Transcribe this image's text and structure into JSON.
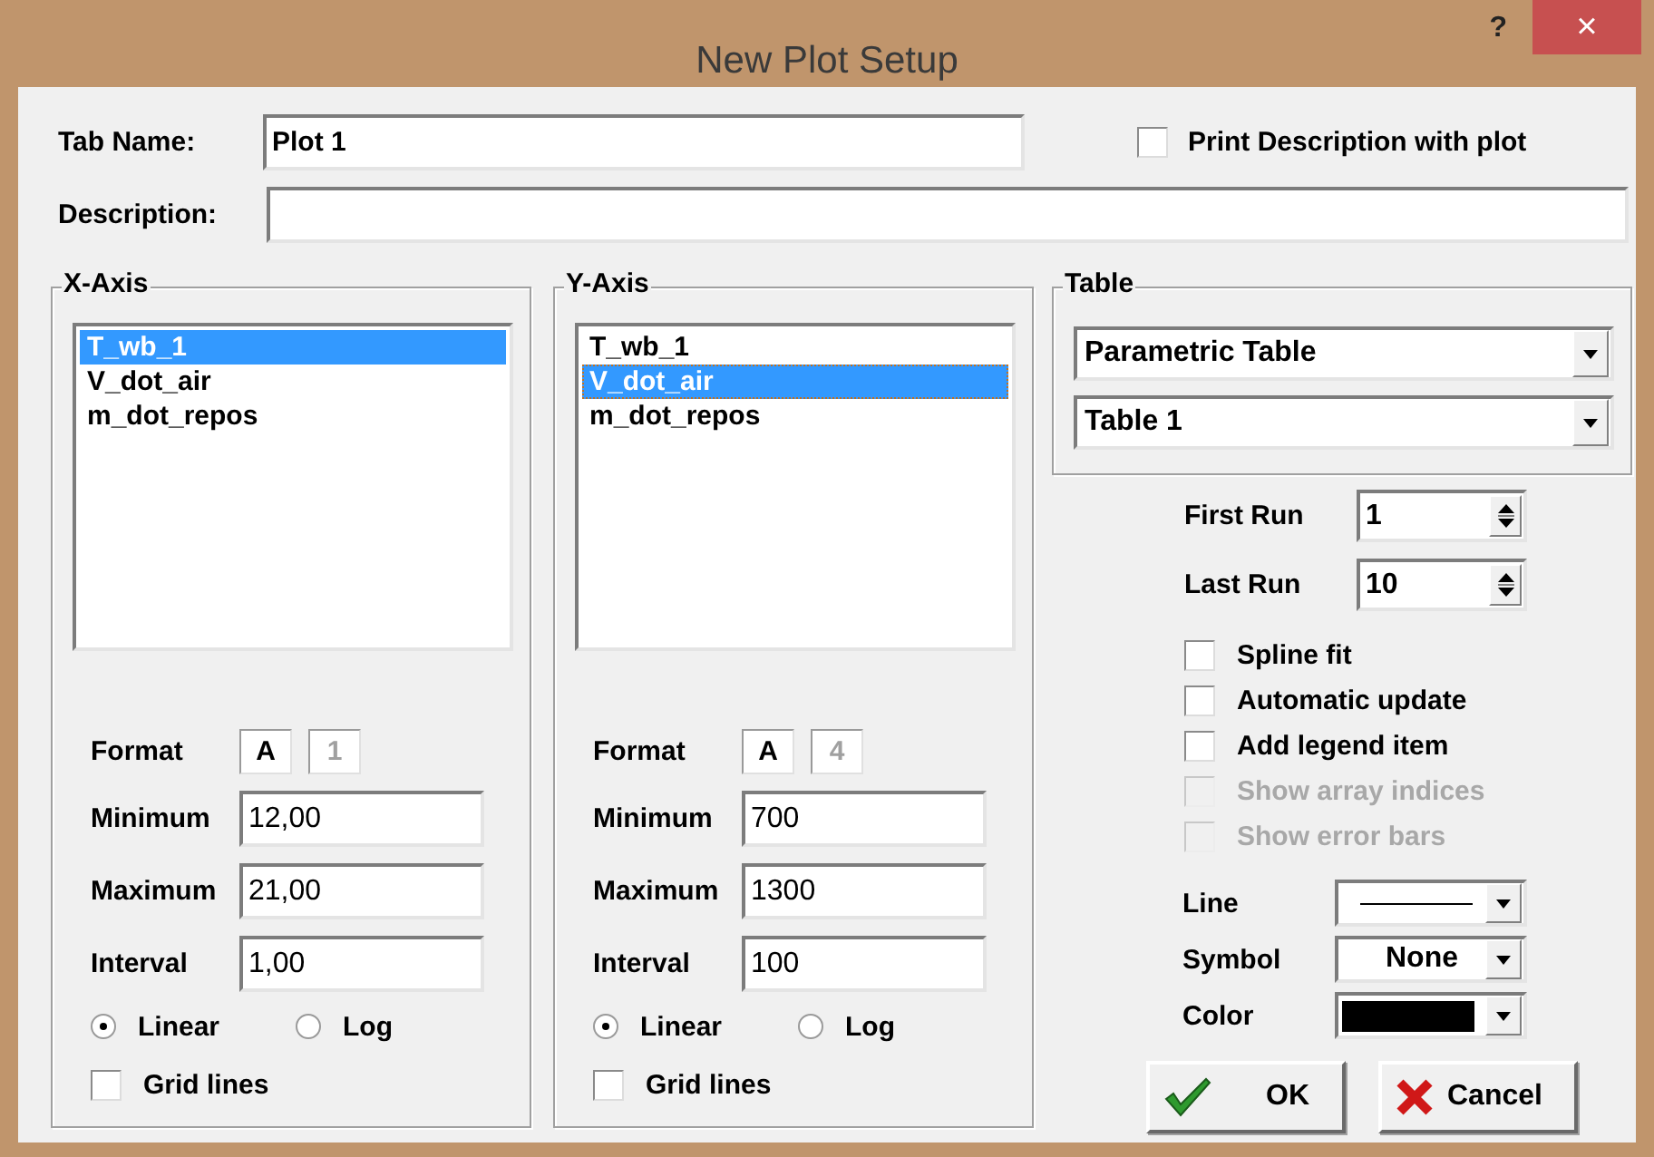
{
  "window": {
    "title": "New Plot Setup",
    "help": "?",
    "close": "×"
  },
  "tab_name": {
    "label": "Tab Name:",
    "value": "Plot 1"
  },
  "print_description": {
    "label": "Print Description with plot",
    "checked": false
  },
  "description": {
    "label": "Description:"
  },
  "axes": [
    {
      "title": "X-Axis",
      "variables": [
        {
          "name": "T_wb_1",
          "selected": true,
          "focused": false
        },
        {
          "name": "V_dot_air",
          "selected": false,
          "focused": false
        },
        {
          "name": "m_dot_repos",
          "selected": false,
          "focused": false
        }
      ],
      "format": {
        "label": "Format",
        "buttons": [
          {
            "text": "A",
            "disabled": false
          },
          {
            "text": "1",
            "disabled": true
          }
        ]
      },
      "fields": [
        {
          "label": "Minimum",
          "value": "12,00"
        },
        {
          "label": "Maximum",
          "value": "21,00"
        },
        {
          "label": "Interval",
          "value": "1,00"
        }
      ],
      "scale": [
        {
          "label": "Linear",
          "selected": true
        },
        {
          "label": "Log",
          "selected": false
        }
      ],
      "grid_lines": {
        "label": "Grid lines",
        "checked": false
      }
    },
    {
      "title": "Y-Axis",
      "variables": [
        {
          "name": "T_wb_1",
          "selected": false,
          "focused": false
        },
        {
          "name": "V_dot_air",
          "selected": true,
          "focused": true
        },
        {
          "name": "m_dot_repos",
          "selected": false,
          "focused": false
        }
      ],
      "format": {
        "label": "Format",
        "buttons": [
          {
            "text": "A",
            "disabled": false
          },
          {
            "text": "4",
            "disabled": true
          }
        ]
      },
      "fields": [
        {
          "label": "Minimum",
          "value": "700"
        },
        {
          "label": "Maximum",
          "value": "1300"
        },
        {
          "label": "Interval",
          "value": "100"
        }
      ],
      "scale": [
        {
          "label": "Linear",
          "selected": true
        },
        {
          "label": "Log",
          "selected": false
        }
      ],
      "grid_lines": {
        "label": "Grid lines",
        "checked": false
      }
    }
  ],
  "table": {
    "title": "Table",
    "dropdowns": [
      "Parametric Table",
      "Table 1"
    ]
  },
  "runs": [
    {
      "label": "First Run",
      "value": "1"
    },
    {
      "label": "Last Run",
      "value": "10"
    }
  ],
  "options": [
    {
      "label": "Spline fit",
      "checked": false,
      "disabled": false
    },
    {
      "label": "Automatic update",
      "checked": false,
      "disabled": false
    },
    {
      "label": "Add legend item",
      "checked": false,
      "disabled": false
    },
    {
      "label": "Show array indices",
      "checked": false,
      "disabled": true
    },
    {
      "label": "Show error bars",
      "checked": false,
      "disabled": true
    }
  ],
  "style": [
    {
      "label": "Line",
      "kind": "line"
    },
    {
      "label": "Symbol",
      "kind": "text",
      "value": "None"
    },
    {
      "label": "Color",
      "kind": "color",
      "color": "#000000"
    }
  ],
  "buttons": [
    {
      "label": "OK",
      "kind": "ok"
    },
    {
      "label": "Cancel",
      "kind": "cancel"
    }
  ]
}
